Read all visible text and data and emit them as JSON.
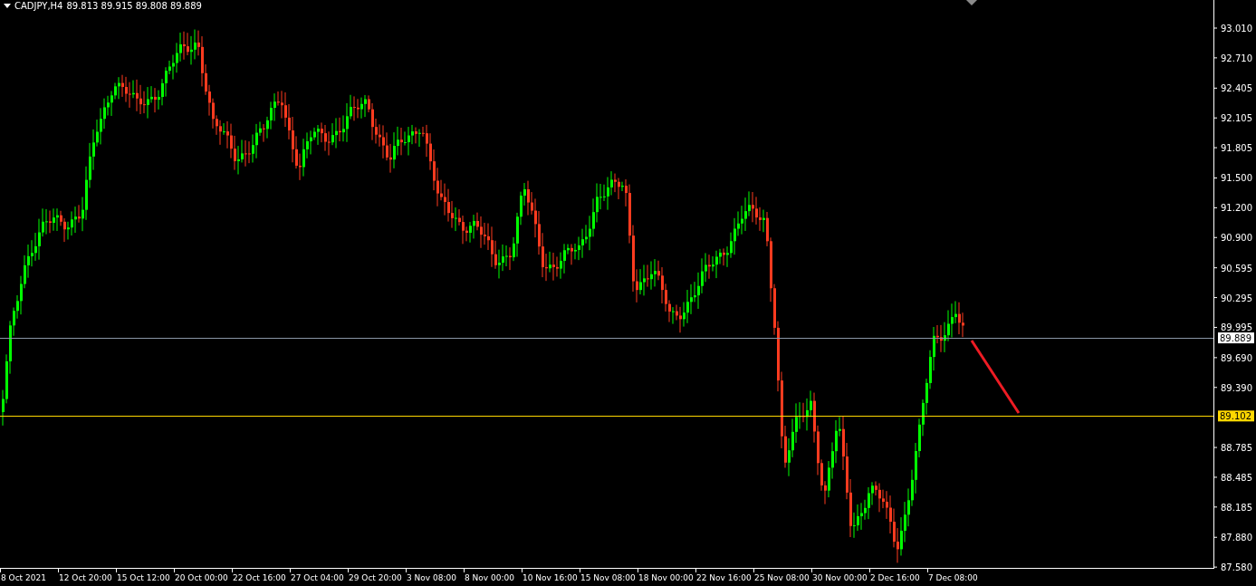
{
  "header": {
    "symbol": "CADJPY,H4",
    "ohlc": "89.813 89.915 89.808 89.889"
  },
  "price_axis": {
    "ticks": [
      "93.010",
      "92.710",
      "92.405",
      "92.105",
      "91.805",
      "91.500",
      "91.200",
      "90.900",
      "90.595",
      "90.295",
      "89.995",
      "89.690",
      "89.390",
      "88.785",
      "88.485",
      "88.185",
      "87.880",
      "87.580"
    ]
  },
  "price_markers": [
    {
      "label": "89.889",
      "kind": "bid",
      "color": "#ffffff"
    },
    {
      "label": "89.102",
      "kind": "level",
      "color": "#ffd700"
    }
  ],
  "time_axis": {
    "labels": [
      "8 Oct 2021",
      "12 Oct 20:00",
      "15 Oct 12:00",
      "20 Oct 00:00",
      "22 Oct 16:00",
      "27 Oct 04:00",
      "29 Oct 20:00",
      "3 Nov 08:00",
      "8 Nov 00:00",
      "10 Nov 16:00",
      "15 Nov 08:00",
      "18 Nov 00:00",
      "22 Nov 16:00",
      "25 Nov 08:00",
      "30 Nov 00:00",
      "2 Dec 16:00",
      "7 Dec 08:00"
    ]
  }
}
